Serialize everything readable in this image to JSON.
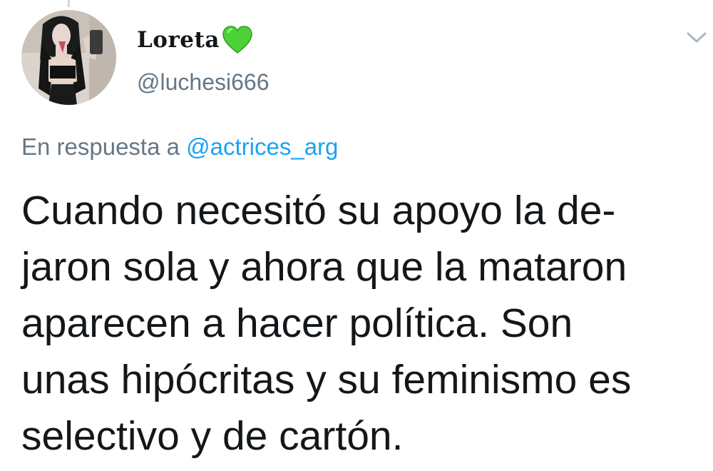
{
  "user": {
    "display_name": "Loreta",
    "handle": "@luchesi666",
    "avatar_icon": "profile-photo",
    "name_emoji_icon": "green-heart-icon",
    "name_emoji_color": "#4cd137"
  },
  "menu": {
    "icon": "chevron-down-icon"
  },
  "reply": {
    "prefix": "En respuesta a",
    "mention": "@actrices_arg"
  },
  "tweet": {
    "lines": [
      "Cuando necesitó su apoyo la de-",
      "jaron sola y ahora que la mataron",
      "aparecen a hacer política. Son",
      "unas hipócritas y su feminismo es",
      "selectivo y de cartón."
    ]
  },
  "colors": {
    "text": "#14171a",
    "secondary": "#657786",
    "link": "#1da1f2"
  }
}
